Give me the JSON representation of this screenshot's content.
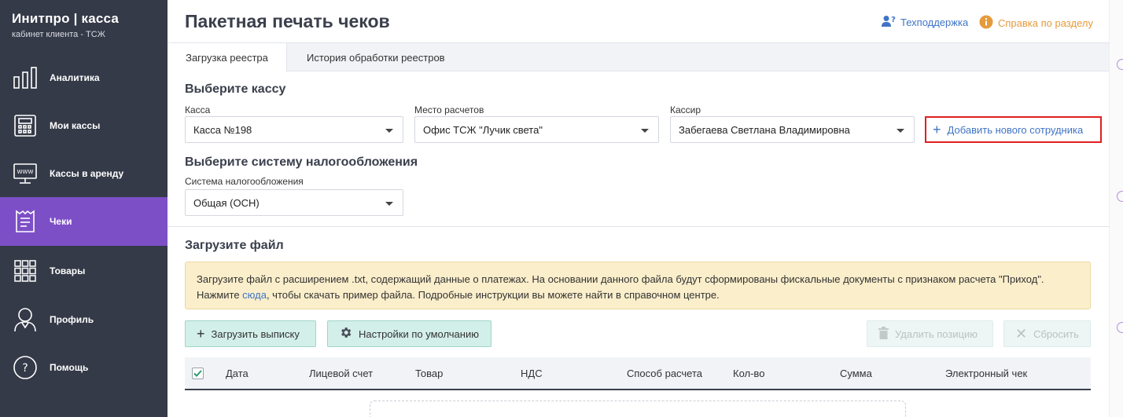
{
  "brand": {
    "title": "Инитпро | касса",
    "subtitle": "кабинет клиента - ТСЖ"
  },
  "sidebar": {
    "items": [
      {
        "label": "Аналитика",
        "icon": "analytics-icon"
      },
      {
        "label": "Мои кассы",
        "icon": "cash-register-icon"
      },
      {
        "label": "Кассы в аренду",
        "icon": "www-terminal-icon"
      },
      {
        "label": "Чеки",
        "icon": "receipt-icon",
        "active": true
      },
      {
        "label": "Товары",
        "icon": "grid-icon"
      },
      {
        "label": "Профиль",
        "icon": "user-icon"
      },
      {
        "label": "Помощь",
        "icon": "help-circle-icon"
      }
    ]
  },
  "header": {
    "title": "Пакетная печать чеков",
    "support": "Техподдержка",
    "help": "Справка по разделу"
  },
  "tabs": [
    {
      "label": "Загрузка реестра",
      "active": true
    },
    {
      "label": "История обработки реестров",
      "active": false
    }
  ],
  "kassa_section": {
    "title": "Выберите кассу",
    "kassa_label": "Касса",
    "kassa_value": "Касса №198",
    "place_label": "Место расчетов",
    "place_value": "Офис ТСЖ \"Лучик света\"",
    "cashier_label": "Кассир",
    "cashier_value": "Забегаева Светлана Владимировна",
    "add_employee": "Добавить нового сотрудника"
  },
  "tax_section": {
    "title": "Выберите систему налогообложения",
    "label": "Система налогообложения",
    "value": "Общая (ОСН)"
  },
  "upload_section": {
    "title": "Загрузите файл",
    "notice_line1": "Загрузите файл с расширением .txt, содержащий данные о платежах. На основании данного файла будут сформированы фискальные документы с признаком расчета \"Приход\".",
    "notice_pre": "Нажмите ",
    "notice_link": "сюда",
    "notice_post": ", чтобы скачать пример файла. Подробные инструкции вы можете найти в справочном центре.",
    "upload_btn": "Загрузить выписку",
    "settings_btn": "Настройки по умолчанию",
    "delete_btn": "Удалить позицию",
    "reset_btn": "Сбросить"
  },
  "table": {
    "columns": [
      "Дата",
      "Лицевой счет",
      "Товар",
      "НДС",
      "Способ расчета",
      "Кол-во",
      "Сумма",
      "Электронный чек"
    ]
  },
  "colors": {
    "sidebar": "#353a48",
    "active": "#7d4fc7",
    "link": "#3f74c5",
    "help": "#e69a3a",
    "highlight": "#e02020"
  }
}
